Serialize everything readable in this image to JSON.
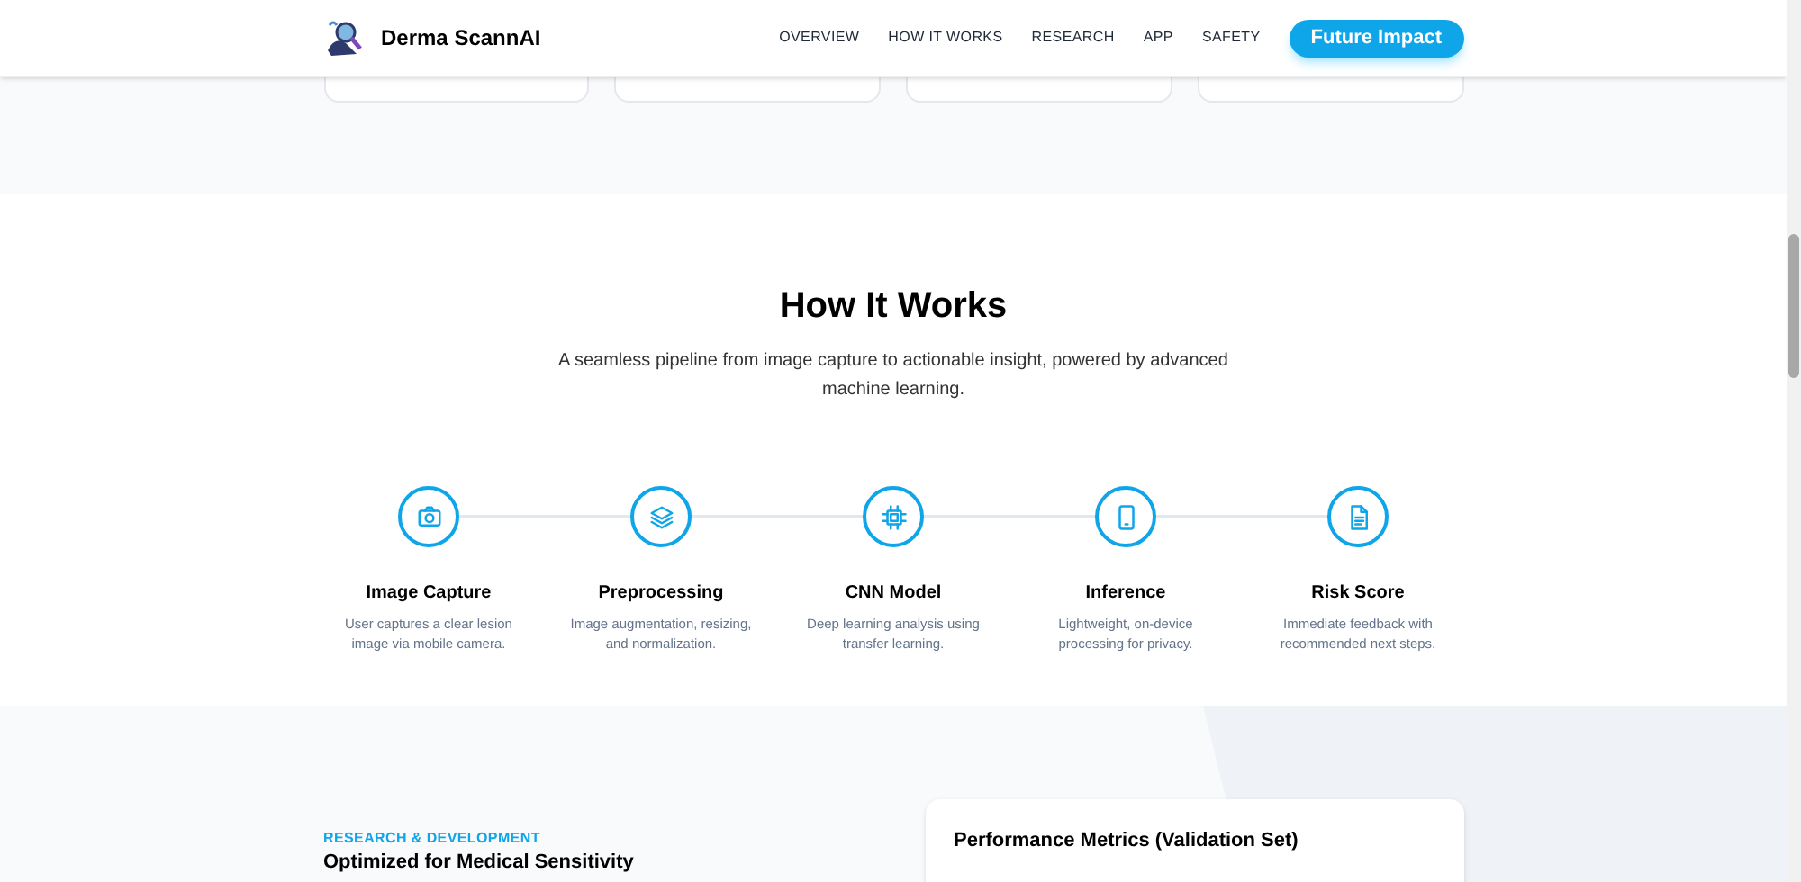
{
  "header": {
    "brand": "Derma ScannAI",
    "nav": [
      {
        "label": "OVERVIEW"
      },
      {
        "label": "HOW IT WORKS"
      },
      {
        "label": "RESEARCH"
      },
      {
        "label": "APP"
      },
      {
        "label": "SAFETY"
      }
    ],
    "cta": "Future Impact"
  },
  "how_it_works": {
    "title": "How It Works",
    "subtitle": "A seamless pipeline from image capture to actionable insight, powered by advanced machine learning.",
    "steps": [
      {
        "kind": "camera",
        "title": "Image Capture",
        "text": "User captures a clear lesion image via mobile camera."
      },
      {
        "kind": "layers",
        "title": "Preprocessing",
        "text": "Image augmentation, resizing, and normalization."
      },
      {
        "kind": "chip",
        "title": "CNN Model",
        "text": "Deep learning analysis using transfer learning."
      },
      {
        "kind": "phone",
        "title": "Inference",
        "text": "Lightweight, on-device processing for privacy."
      },
      {
        "kind": "document",
        "title": "Risk Score",
        "text": "Immediate feedback with recommended next steps."
      }
    ]
  },
  "research": {
    "eyebrow": "RESEARCH & DEVELOPMENT",
    "heading": "Optimized for Medical Sensitivity",
    "card_title": "Performance Metrics (Validation Set)"
  }
}
